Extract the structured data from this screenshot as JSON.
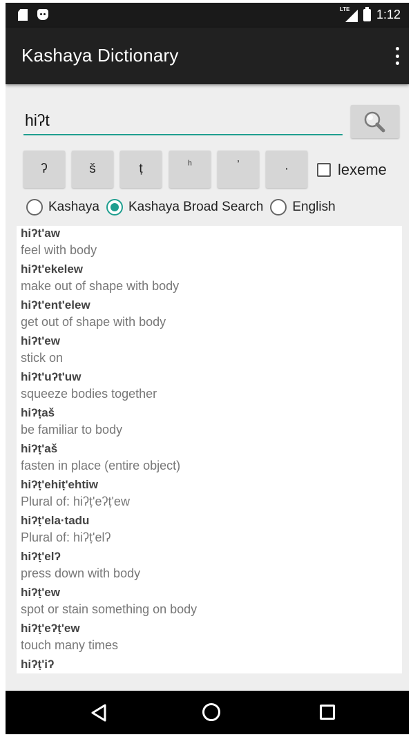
{
  "status_bar": {
    "time": "1:12",
    "network_label": "LTE",
    "icons": [
      "sd-card-icon",
      "android-notification-icon",
      "lte-signal-icon",
      "battery-icon"
    ]
  },
  "app_bar": {
    "title": "Kashaya Dictionary",
    "menu_icon": "overflow-menu-icon"
  },
  "search": {
    "value": "hiʔt",
    "placeholder": "",
    "button_icon": "magnifier-icon",
    "accent_color": "#1f9e8f"
  },
  "special_keys": [
    "ʔ",
    "š",
    "ṭ",
    "ʰ",
    "ʼ",
    "·"
  ],
  "lexeme": {
    "label": "lexeme",
    "checked": false
  },
  "search_modes": [
    {
      "label": "Kashaya",
      "selected": false
    },
    {
      "label": "Kashaya Broad Search",
      "selected": true
    },
    {
      "label": "English",
      "selected": false
    }
  ],
  "results": [
    {
      "word": "hiʔt'aw",
      "definition": "feel with body"
    },
    {
      "word": "hiʔt'ekelew",
      "definition": "make out of shape with body"
    },
    {
      "word": "hiʔt'ent'elew",
      "definition": "get out of shape with body"
    },
    {
      "word": "hiʔt'ew",
      "definition": "stick on"
    },
    {
      "word": "hiʔt'uʔt'uw",
      "definition": "squeeze bodies together"
    },
    {
      "word": "hiʔṭaš",
      "definition": "be familiar to body"
    },
    {
      "word": "hiʔṭ'aš",
      "definition": "fasten in place (entire object)"
    },
    {
      "word": "hiʔṭ'ehiṭ'ehtiw",
      "definition": "Plural of: hiʔṭ'eʔṭ'ew"
    },
    {
      "word": "hiʔṭ'ela·tadu",
      "definition": "Plural of: hiʔṭ'elʔ"
    },
    {
      "word": "hiʔṭ'elʔ",
      "definition": "press down with body"
    },
    {
      "word": "hiʔṭ'ew",
      "definition": "spot or stain something on body"
    },
    {
      "word": "hiʔṭ'eʔṭ'ew",
      "definition": "touch many times"
    },
    {
      "word": "hiʔṭ'iʔ",
      "definition": ""
    }
  ],
  "nav_bar": {
    "icons": [
      "back-icon",
      "home-icon",
      "recents-icon"
    ]
  }
}
